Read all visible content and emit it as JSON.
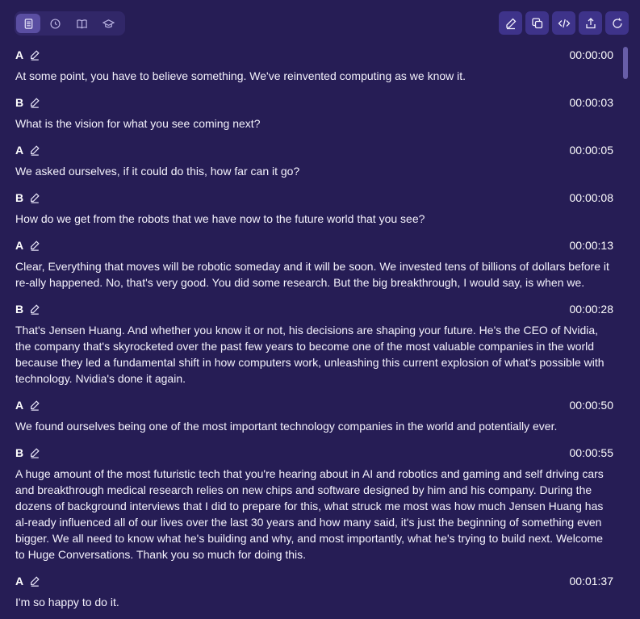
{
  "toolbar": {
    "tabs": [
      {
        "icon": "document-icon",
        "active": true
      },
      {
        "icon": "clock-icon",
        "active": false
      },
      {
        "icon": "book-icon",
        "active": false
      },
      {
        "icon": "graduation-cap-icon",
        "active": false
      }
    ],
    "actions": [
      "pencil-icon",
      "copy-icon",
      "code-icon",
      "share-icon",
      "refresh-icon"
    ]
  },
  "transcript": [
    {
      "speaker": "A",
      "time": "00:00:00",
      "text": "At some point, you have to believe something. We've reinvented computing as we know it."
    },
    {
      "speaker": "B",
      "time": "00:00:03",
      "text": "What is the vision for what you see coming next?"
    },
    {
      "speaker": "A",
      "time": "00:00:05",
      "text": "We asked ourselves, if it could do this, how far can it go?"
    },
    {
      "speaker": "B",
      "time": "00:00:08",
      "text": "How do we get from the robots that we have now to the future world that you see?"
    },
    {
      "speaker": "A",
      "time": "00:00:13",
      "text": "Clear, Everything that moves will be robotic someday and it will be soon. We invested tens of billions of dollars before it re-ally happened. No, that's very good. You did some research. But the big breakthrough, I would say, is when we."
    },
    {
      "speaker": "B",
      "time": "00:00:28",
      "text": "That's Jensen Huang. And whether you know it or not, his decisions are shaping your future. He's the CEO of Nvidia, the company that's skyrocketed over the past few years to become one of the most valuable companies in the world because they led a fundamental shift in how computers work, unleashing this current explosion of what's possible with technology. Nvidia's done it again."
    },
    {
      "speaker": "A",
      "time": "00:00:50",
      "text": "We found ourselves being one of the most important technology companies in the world and potentially ever."
    },
    {
      "speaker": "B",
      "time": "00:00:55",
      "text": "A huge amount of the most futuristic tech that you're hearing about in AI and robotics and gaming and self driving cars and breakthrough medical research relies on new chips and software designed by him and his company. During the dozens of background interviews that I did to prepare for this, what struck me most was how much Jensen Huang has al-ready influenced all of our lives over the last 30 years and how many said, it's just the beginning of something even bigger. We all need to know what he's building and why, and most importantly, what he's trying to build next. Welcome to Huge Conversations. Thank you so much for doing this."
    },
    {
      "speaker": "A",
      "time": "00:01:37",
      "text": "I'm so happy to do it."
    }
  ]
}
